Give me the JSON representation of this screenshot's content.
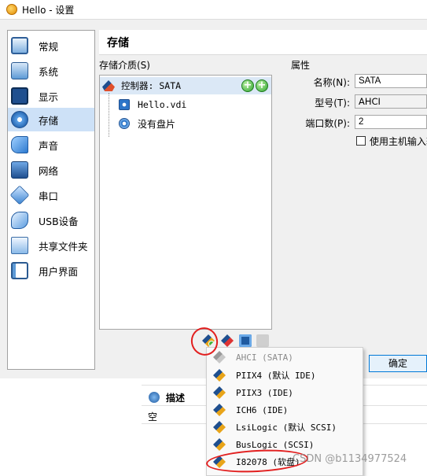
{
  "window": {
    "title": "Hello - 设置"
  },
  "sidebar": {
    "items": [
      {
        "label": "常规",
        "icon": "general-icon"
      },
      {
        "label": "系统",
        "icon": "system-icon"
      },
      {
        "label": "显示",
        "icon": "display-icon"
      },
      {
        "label": "存储",
        "icon": "storage-icon",
        "active": true
      },
      {
        "label": "声音",
        "icon": "audio-icon"
      },
      {
        "label": "网络",
        "icon": "network-icon"
      },
      {
        "label": "串口",
        "icon": "serial-port-icon"
      },
      {
        "label": "USB设备",
        "icon": "usb-icon"
      },
      {
        "label": "共享文件夹",
        "icon": "shared-folder-icon"
      },
      {
        "label": "用户界面",
        "icon": "user-interface-icon"
      }
    ]
  },
  "page": {
    "title": "存储"
  },
  "storage": {
    "tree_label": "存储介质(S)",
    "controller": "控制器: SATA",
    "attachments": [
      {
        "name": "Hello.vdi",
        "icon": "hard-disk-icon"
      },
      {
        "name": "没有盘片",
        "icon": "optical-disk-icon"
      }
    ]
  },
  "attributes": {
    "header": "属性",
    "name_label": "名称(N):",
    "name_value": "SATA",
    "type_label": "型号(T):",
    "type_value": "AHCI",
    "ports_label": "端口数(P):",
    "ports_value": "2",
    "io_cache_label": "使用主机输入输"
  },
  "buttons": {
    "ok": "确定"
  },
  "description": {
    "heading": "描述",
    "value": "空"
  },
  "controller_menu": {
    "items": [
      {
        "label": "AHCI (SATA)",
        "enabled": false
      },
      {
        "label": "PIIX4 (默认 IDE)",
        "enabled": true
      },
      {
        "label": "PIIX3 (IDE)",
        "enabled": true
      },
      {
        "label": "ICH6 (IDE)",
        "enabled": true
      },
      {
        "label": "LsiLogic (默认 SCSI)",
        "enabled": true
      },
      {
        "label": "BusLogic (SCSI)",
        "enabled": true
      },
      {
        "label": "I82078 (软盘)",
        "enabled": true
      }
    ]
  },
  "watermark": "CSDN @b1134977524",
  "colors": {
    "accent": "#0078d7",
    "annotation": "#e21f1f",
    "selection": "#cde1f7"
  }
}
